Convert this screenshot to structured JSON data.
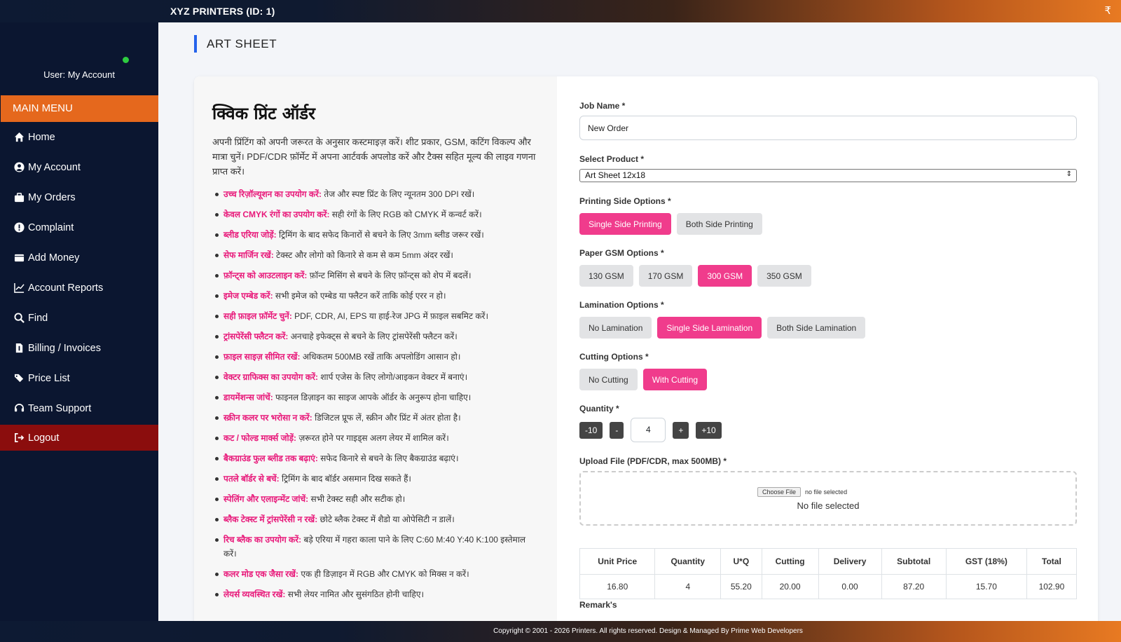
{
  "header": {
    "brand": "XYZ PRINTERS (ID: 1)",
    "wallet_icon": "₹"
  },
  "sidebar": {
    "user": "User: My Account",
    "main_menu": "MAIN MENU",
    "items": [
      {
        "label": "Home",
        "icon": "home-icon"
      },
      {
        "label": "My Account",
        "icon": "user-circle-icon"
      },
      {
        "label": "My Orders",
        "icon": "briefcase-icon"
      },
      {
        "label": "Complaint",
        "icon": "exclamation-circle-icon"
      },
      {
        "label": "Add Money",
        "icon": "wallet-icon"
      },
      {
        "label": "Account Reports",
        "icon": "line-chart-icon"
      },
      {
        "label": "Find",
        "icon": "search-icon"
      },
      {
        "label": "Billing / Invoices",
        "icon": "invoice-icon"
      },
      {
        "label": "Price List",
        "icon": "tags-icon"
      },
      {
        "label": "Team Support",
        "icon": "headset-icon"
      },
      {
        "label": "Logout",
        "icon": "sign-out-icon"
      }
    ]
  },
  "page": {
    "title": "ART SHEET"
  },
  "info": {
    "heading": "क्विक प्रिंट ऑर्डर",
    "intro": "अपनी प्रिंटिंग को अपनी जरूरत के अनुसार कस्टमाइज़ करें। शीट प्रकार, GSM, कटिंग विकल्प और मात्रा चुनें। PDF/CDR फ़ॉर्मेट में अपना आर्टवर्क अपलोड करें और टैक्स सहित मूल्य की लाइव गणना प्राप्त करें।",
    "tips": [
      {
        "title": "उच्च रिज़ॉल्यूशन का उपयोग करें:",
        "text": " तेज और स्पष्ट प्रिंट के लिए न्यूनतम 300 DPI रखें।"
      },
      {
        "title": "केवल CMYK रंगों का उपयोग करें:",
        "text": " सही रंगों के लिए RGB को CMYK में कन्वर्ट करें।"
      },
      {
        "title": "ब्लीड एरिया जोड़ें:",
        "text": " ट्रिमिंग के बाद सफेद किनारों से बचने के लिए 3mm ब्लीड जरूर रखें।"
      },
      {
        "title": "सेफ मार्जिन रखें:",
        "text": " टेक्स्ट और लोगो को किनारे से कम से कम 5mm अंदर रखें।"
      },
      {
        "title": "फ़ॉन्ट्स को आउटलाइन करें:",
        "text": " फ़ॉन्ट मिसिंग से बचने के लिए फ़ॉन्ट्स को शेप में बदलें।"
      },
      {
        "title": "इमेज एम्बेड करें:",
        "text": " सभी इमेज को एम्बेड या फ्लैटन करें ताकि कोई एरर न हो।"
      },
      {
        "title": "सही फ़ाइल फ़ॉर्मेट चुनें:",
        "text": " PDF, CDR, AI, EPS या हाई-रेज JPG में फ़ाइल सबमिट करें।"
      },
      {
        "title": "ट्रांसपेरेंसी फ्लैटन करें:",
        "text": " अनचाहे इफेक्ट्स से बचने के लिए ट्रांसपेरेंसी फ्लैटन करें।"
      },
      {
        "title": "फ़ाइल साइज़ सीमित रखें:",
        "text": " अधिकतम 500MB रखें ताकि अपलोडिंग आसान हो।"
      },
      {
        "title": "वेक्टर ग्राफिक्स का उपयोग करें:",
        "text": " शार्प एजेस के लिए लोगो/आइकन वेक्टर में बनाएं।"
      },
      {
        "title": "डायमेंशन्स जांचें:",
        "text": " फाइनल डिज़ाइन का साइज आपके ऑर्डर के अनुरूप होना चाहिए।"
      },
      {
        "title": "स्क्रीन कलर पर भरोसा न करें:",
        "text": " डिजिटल प्रूफ लें, स्क्रीन और प्रिंट में अंतर होता है।"
      },
      {
        "title": "कट / फोल्ड मार्क्स जोड़ें:",
        "text": " ज़रूरत होने पर गाइड्स अलग लेयर में शामिल करें।"
      },
      {
        "title": "बैकग्राउंड फुल ब्लीड तक बढ़ाएं:",
        "text": " सफेद किनारे से बचने के लिए बैकग्राउंड बढ़ाएं।"
      },
      {
        "title": "पतले बॉर्डर से बचें:",
        "text": " ट्रिमिंग के बाद बॉर्डर असमान दिख सकते हैं।"
      },
      {
        "title": "स्पेलिंग और एलाइन्मेंट जांचें:",
        "text": " सभी टेक्स्ट सही और सटीक हो।"
      },
      {
        "title": "ब्लैक टेक्स्ट में ट्रांसपेरेंसी न रखें:",
        "text": " छोटे ब्लैक टेक्स्ट में शैडो या ओपेसिटी न डालें।"
      },
      {
        "title": "रिच ब्लैक का उपयोग करें:",
        "text": " बड़े एरिया में गहरा काला पाने के लिए C:60 M:40 Y:40 K:100 इस्तेमाल करें।"
      },
      {
        "title": "कलर मोड एक जैसा रखें:",
        "text": " एक ही डिज़ाइन में RGB और CMYK को मिक्स न करें।"
      },
      {
        "title": "लेयर्स व्यवस्थित रखें:",
        "text": " सभी लेयर नामित और सुसंगठित होनी चाहिए।"
      }
    ]
  },
  "form": {
    "job_label": "Job Name *",
    "job_value": "New Order",
    "product_label": "Select Product *",
    "product_value": "Art Sheet 12x18",
    "side_label": "Printing Side Options *",
    "side_options": [
      "Single Side Printing",
      "Both Side Printing"
    ],
    "side_selected": 0,
    "gsm_label": "Paper GSM Options *",
    "gsm_options": [
      "130 GSM",
      "170 GSM",
      "300 GSM",
      "350 GSM"
    ],
    "gsm_selected": 2,
    "lam_label": "Lamination Options *",
    "lam_options": [
      "No Lamination",
      "Single Side Lamination",
      "Both Side Lamination"
    ],
    "lam_selected": 1,
    "cut_label": "Cutting Options *",
    "cut_options": [
      "No Cutting",
      "With Cutting"
    ],
    "cut_selected": 1,
    "qty_label": "Quantity *",
    "qty_buttons": [
      "-10",
      "-",
      "+",
      "+10"
    ],
    "qty_value": "4",
    "upload_label": "Upload File (PDF/CDR, max 500MB) *",
    "choose_file": "Choose File",
    "no_file_small": "no file selected",
    "no_file": "No file selected",
    "summary_headers": [
      "Unit Price",
      "Quantity",
      "U*Q",
      "Cutting",
      "Delivery",
      "Subtotal",
      "GST (18%)",
      "Total"
    ],
    "summary_values": [
      "16.80",
      "4",
      "55.20",
      "20.00",
      "0.00",
      "87.20",
      "15.70",
      "102.90"
    ],
    "remark_label": "Remark's"
  },
  "footer": {
    "text": "Copyright © 2001 - 2026 Printers. All rights reserved. Design & Managed By Prime Web Developers"
  },
  "colors": {
    "accent_pink": "#f03c8c",
    "menu_orange": "#e5681d",
    "logout_red": "#8b0d0d",
    "sidebar_bg": "#0b1630",
    "title_bar": "#2563eb"
  }
}
